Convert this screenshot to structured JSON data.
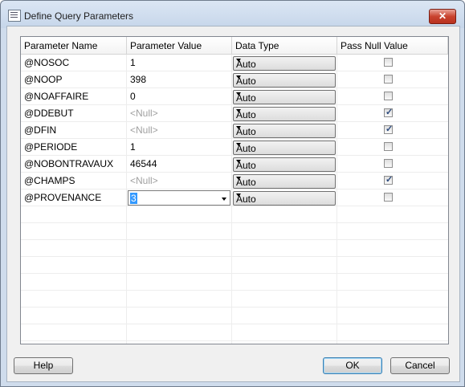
{
  "window": {
    "title": "Define Query Parameters",
    "close_label": "✕"
  },
  "grid": {
    "columns": [
      "Parameter Name",
      "Parameter Value",
      "Data Type",
      "Pass Null Value"
    ],
    "rows": [
      {
        "name": "@NOSOC",
        "value": "1",
        "value_is_null": false,
        "type": "Auto",
        "pass_null": false
      },
      {
        "name": "@NOOP",
        "value": "398",
        "value_is_null": false,
        "type": "Auto",
        "pass_null": false
      },
      {
        "name": "@NOAFFAIRE",
        "value": "0",
        "value_is_null": false,
        "type": "Auto",
        "pass_null": false
      },
      {
        "name": "@DDEBUT",
        "value": "<Null>",
        "value_is_null": true,
        "type": "Auto",
        "pass_null": true
      },
      {
        "name": "@DFIN",
        "value": "<Null>",
        "value_is_null": true,
        "type": "Auto",
        "pass_null": true
      },
      {
        "name": "@PERIODE",
        "value": "1",
        "value_is_null": false,
        "type": "Auto",
        "pass_null": false
      },
      {
        "name": "@NOBONTRAVAUX",
        "value": "46544",
        "value_is_null": false,
        "type": "Auto",
        "pass_null": false
      },
      {
        "name": "@CHAMPS",
        "value": "<Null>",
        "value_is_null": true,
        "type": "Auto",
        "pass_null": true
      },
      {
        "name": "@PROVENANCE",
        "value": "3",
        "value_is_null": false,
        "type": "Auto",
        "pass_null": false,
        "editing": true
      }
    ]
  },
  "buttons": {
    "help": "Help",
    "ok": "OK",
    "cancel": "Cancel"
  },
  "icons": {
    "app": "query-parameters-icon",
    "close": "close-icon",
    "dropdown": "chevron-down-icon",
    "check": "checkmark-icon"
  },
  "colors": {
    "selection": "#3399ff",
    "close": "#c9432f"
  }
}
